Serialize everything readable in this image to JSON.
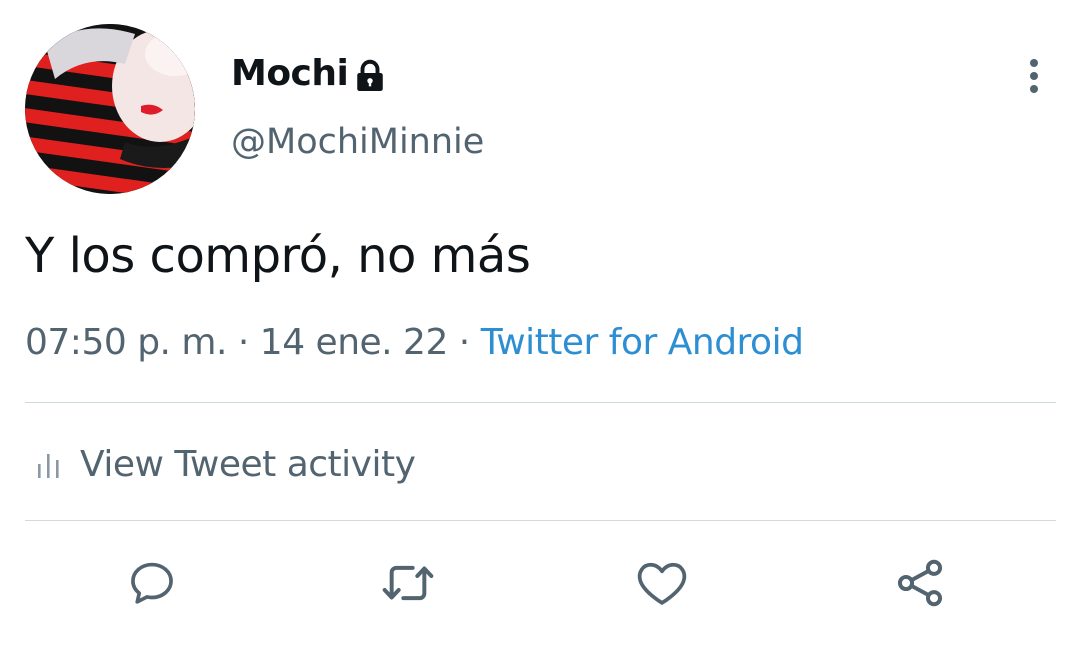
{
  "tweet": {
    "author": {
      "display_name": "Mochi",
      "username": "@MochiMinnie",
      "protected_icon": "lock-icon",
      "avatar": "profile-photo"
    },
    "text": "Y los compró, no más",
    "meta": {
      "time": "07:50 p. m.",
      "separator1": " · ",
      "date": "14 ene. 22",
      "separator2": " · ",
      "source": "Twitter for Android"
    },
    "activity_label": "View Tweet activity",
    "actions": [
      {
        "name": "reply",
        "icon": "reply-icon"
      },
      {
        "name": "retweet",
        "icon": "retweet-icon"
      },
      {
        "name": "like",
        "icon": "heart-icon"
      },
      {
        "name": "share",
        "icon": "share-icon"
      }
    ]
  },
  "colors": {
    "text_primary": "#0f1419",
    "text_secondary": "#536471",
    "link": "#2d8fd2",
    "divider": "#cfd9de"
  }
}
